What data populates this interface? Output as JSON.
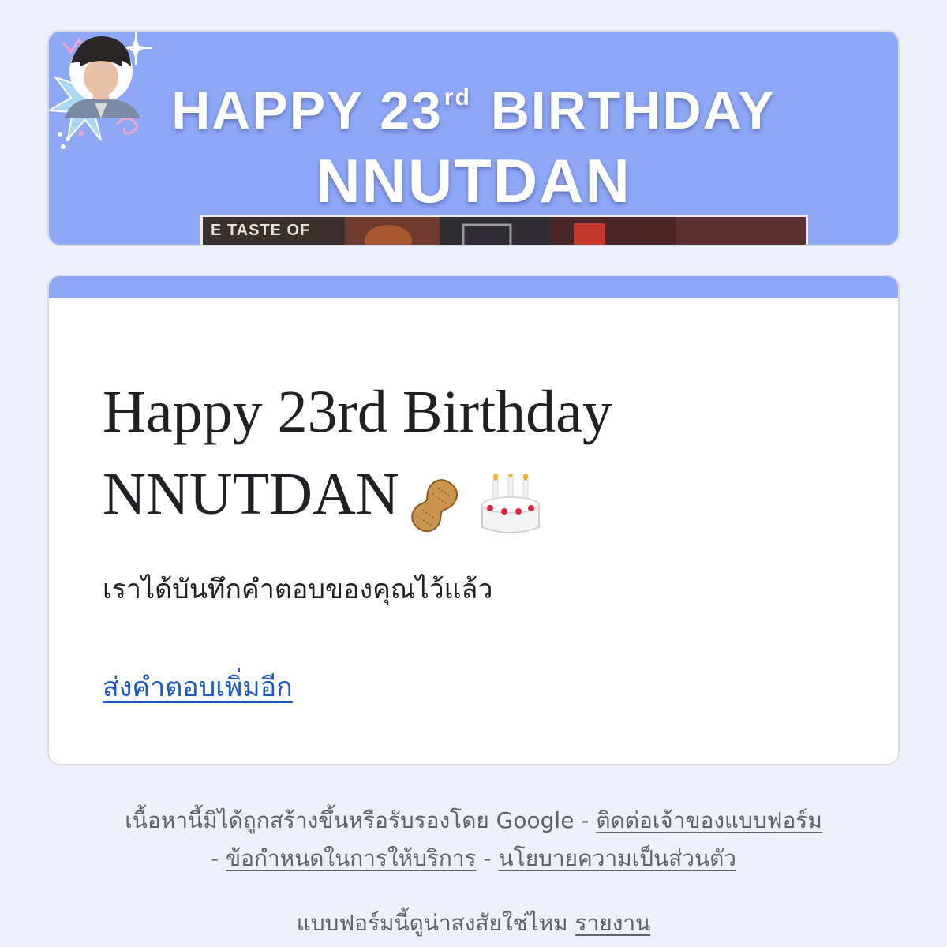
{
  "banner": {
    "line1_prefix": "HAPPY 23",
    "line1_superscript": "rd",
    "line1_suffix": "BIRTHDAY",
    "line2": "NNUTDAN",
    "photo_caption": "E TASTE OF",
    "background_color": "#8ea7f7"
  },
  "card": {
    "accent_color": "#8ea7f7",
    "title_line1": "Happy 23rd Birthday",
    "title_line2": "NNUTDAN",
    "title_icons": [
      "peanut-icon",
      "birthday-cake-icon"
    ],
    "confirmation_message": "เราได้บันทึกคำตอบของคุณไว้แล้ว",
    "submit_another_link": "ส่งคำตอบเพิ่มอีก",
    "link_color": "#1a57c9"
  },
  "footer": {
    "disclaimer": "เนื้อหานี้มิได้ถูกสร้างขึ้นหรือรับรองโดย Google -",
    "contact_owner_link": "ติดต่อเจ้าของแบบฟอร์ม",
    "separator": "-",
    "terms_link": "ข้อกำหนดในการให้บริการ",
    "privacy_link": "นโยบายความเป็นส่วนตัว",
    "suspicious_text": "แบบฟอร์มนี้ดูน่าสงสัยใช่ไหม",
    "report_link": "รายงาน"
  }
}
